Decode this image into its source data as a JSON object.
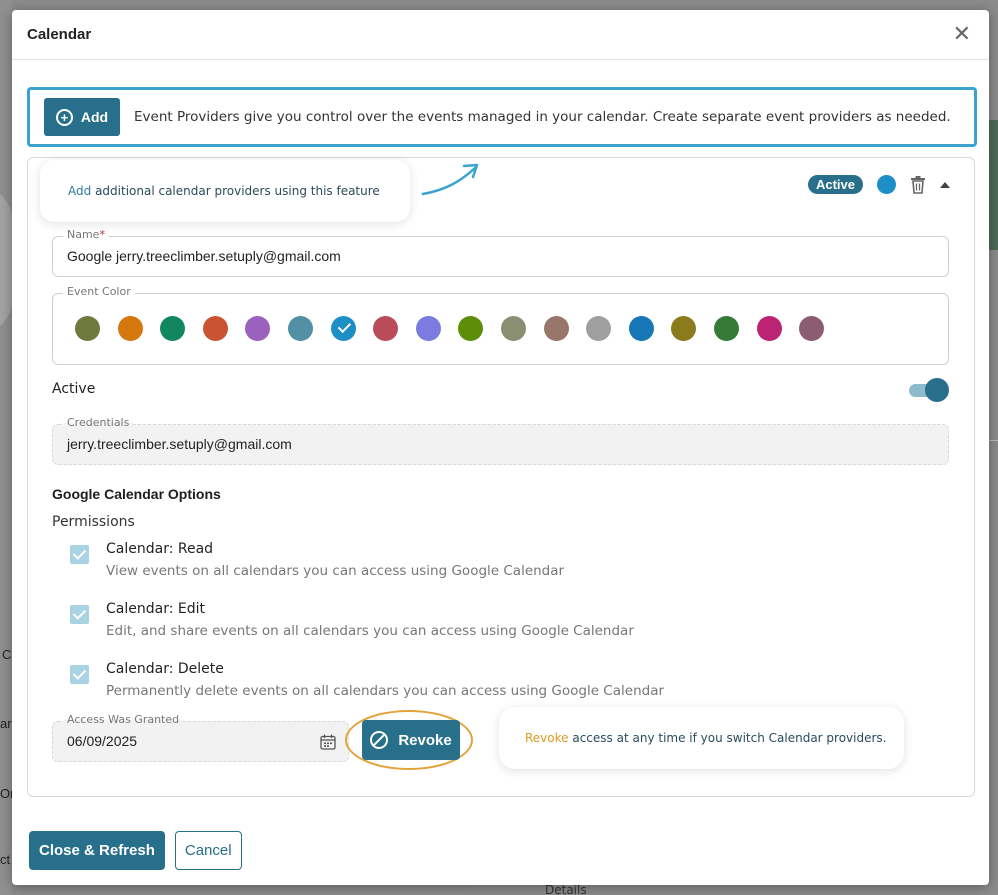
{
  "background": {
    "left_texts": [
      "C",
      "ar",
      "Or",
      "ct"
    ],
    "bottom_text": "Details"
  },
  "modal": {
    "title": "Calendar",
    "close_symbol": "✕"
  },
  "add_bar": {
    "button_label": "Add",
    "button_icon": "plus-circle-icon",
    "description": "Event Providers give you control over the events managed in your calendar. Create separate event providers as needed."
  },
  "tip_add": {
    "highlight": "Add",
    "text": "additional calendar providers using this feature"
  },
  "provider": {
    "status_badge": "Active",
    "selected_color": "#1e8fc6",
    "name_label": "Name",
    "name_required_mark": "*",
    "name_value": "Google jerry.treeclimber.setuply@gmail.com",
    "event_color_label": "Event Color",
    "colors": [
      "#6f7a3e",
      "#d4780e",
      "#12865e",
      "#c95434",
      "#9a62be",
      "#5290a5",
      "#1e8fc6",
      "#b94b5a",
      "#7b7be0",
      "#5d8e0a",
      "#8b8f72",
      "#98776a",
      "#9f9f9f",
      "#1777b7",
      "#8b7b1c",
      "#357a37",
      "#bd2375",
      "#8c5c73"
    ],
    "selected_color_index": 6,
    "active_label": "Active",
    "active_on": true,
    "credentials_label": "Credentials",
    "credentials_value": "jerry.treeclimber.setuply@gmail.com",
    "options_title": "Google Calendar Options",
    "permissions_title": "Permissions",
    "permissions": [
      {
        "title": "Calendar: Read",
        "desc": "View events on all calendars you can access using Google Calendar",
        "checked": true
      },
      {
        "title": "Calendar: Edit",
        "desc": "Edit, and share events on all calendars you can access using Google Calendar",
        "checked": true
      },
      {
        "title": "Calendar: Delete",
        "desc": "Permanently delete events on all calendars you can access using Google Calendar",
        "checked": true
      }
    ],
    "access_label": "Access Was Granted",
    "access_value": "06/09/2025",
    "revoke_label": "Revoke"
  },
  "tip_revoke": {
    "highlight": "Revoke",
    "text": "access at any time if you switch Calendar providers."
  },
  "footer": {
    "close_refresh_label": "Close & Refresh",
    "cancel_label": "Cancel"
  }
}
